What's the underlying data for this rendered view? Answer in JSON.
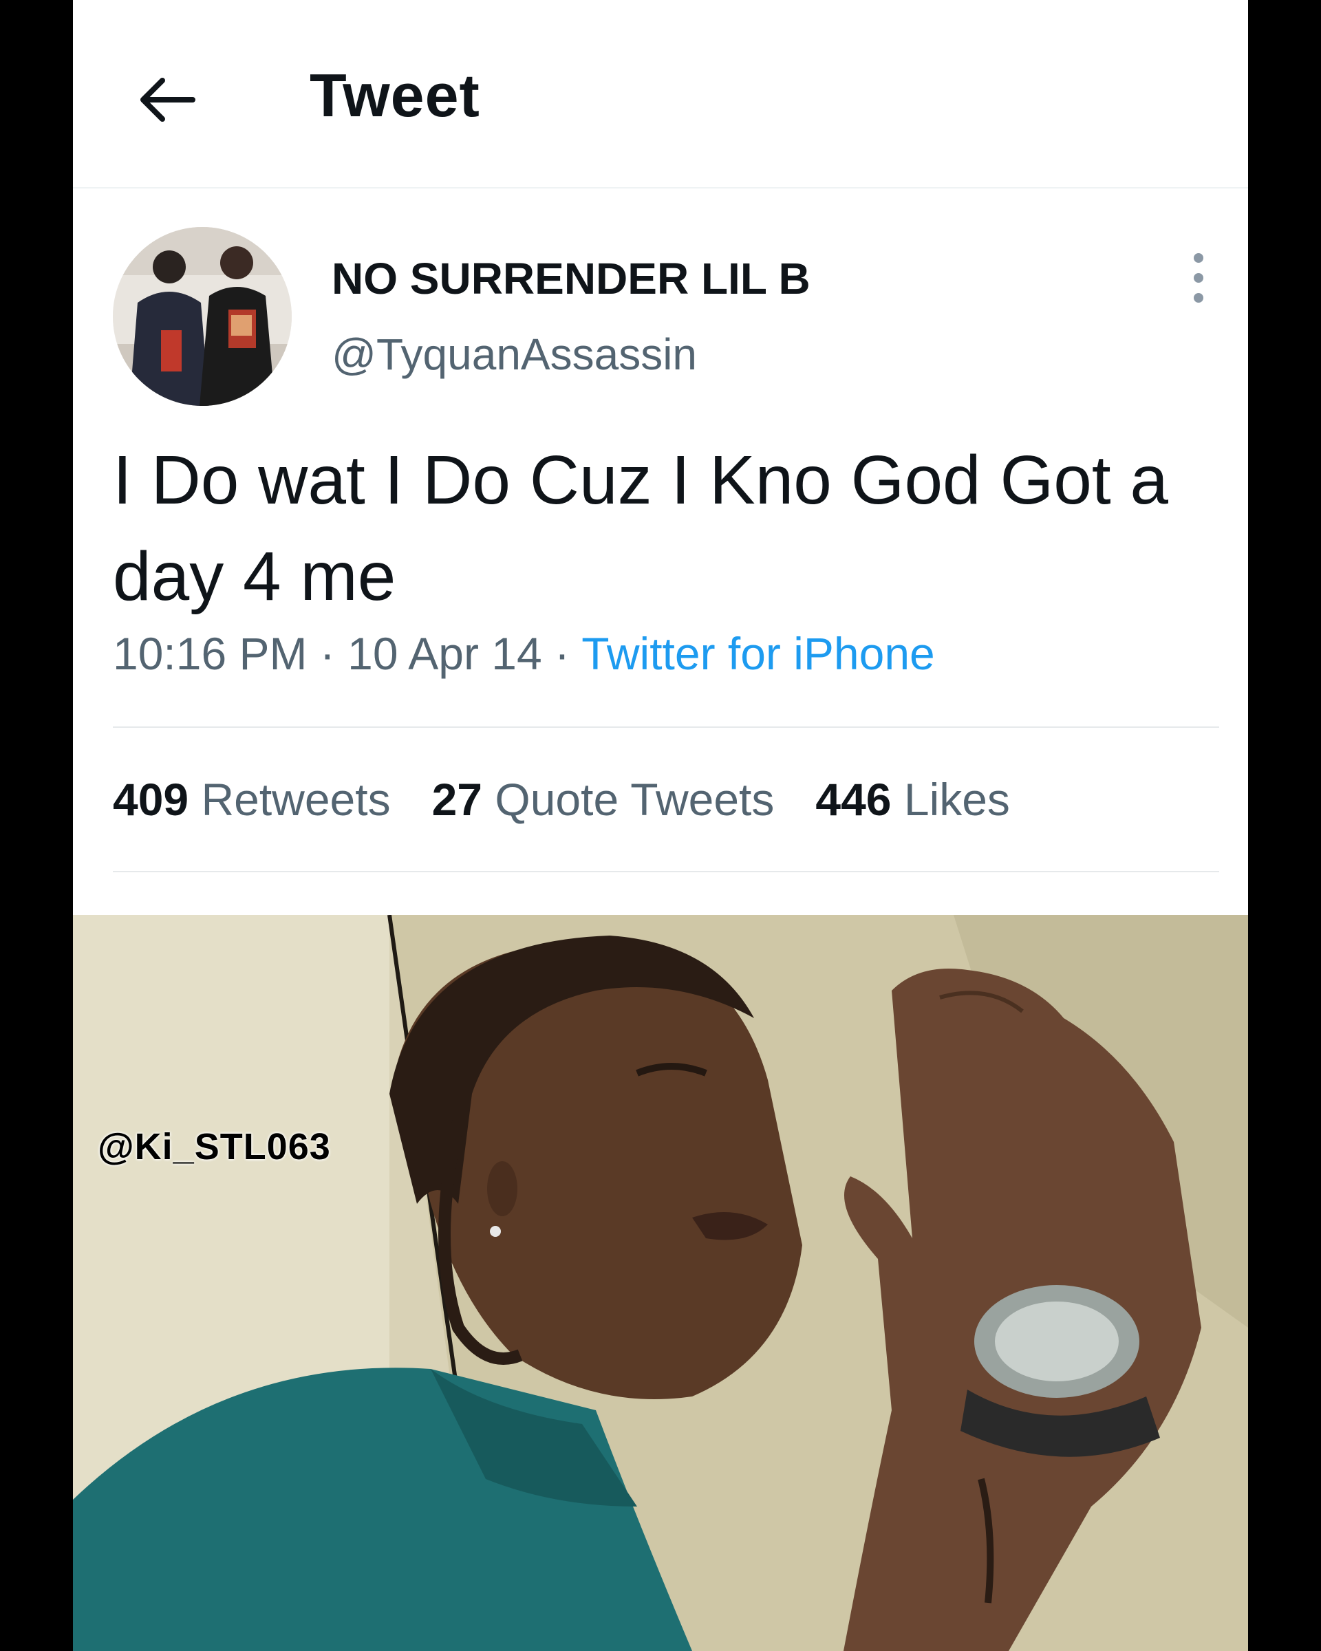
{
  "header": {
    "back_icon": "arrow-left-icon",
    "title": "Tweet"
  },
  "tweet": {
    "display_name": "NO SURRENDER LIL B",
    "handle": "@TyquanAssassin",
    "more_icon": "more-vertical-icon",
    "text": "I Do wat I Do Cuz I Kno God Got a day 4 me",
    "time": "10:16 PM",
    "date": "10 Apr 14",
    "separator": " · ",
    "source": "Twitter for iPhone"
  },
  "stats": {
    "retweets_count": "409",
    "retweets_label": "Retweets",
    "quotes_count": "27",
    "quotes_label": "Quote Tweets",
    "likes_count": "446",
    "likes_label": "Likes"
  },
  "media": {
    "watermark": "@Ki_STL063"
  },
  "colors": {
    "text_primary": "#0f1419",
    "text_secondary": "#536471",
    "link": "#1d9bf0",
    "background": "#ffffff",
    "frame": "#000000"
  }
}
